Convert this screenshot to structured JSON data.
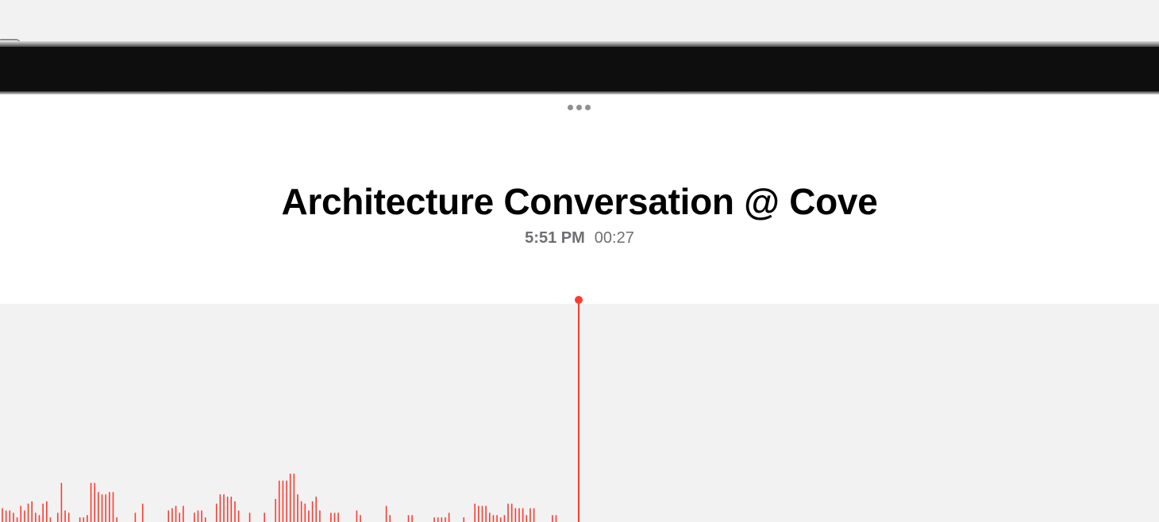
{
  "recording": {
    "title": "Architecture Conversation @ Cove",
    "time": "5:51 PM",
    "duration": "00:27"
  },
  "icons": {
    "more": "ellipsis-icon"
  },
  "colors": {
    "accent": "#ff3b30",
    "secondary_text": "#6f6f74"
  },
  "waveform": {
    "amplitudes": [
      0.06,
      0.05,
      0.05,
      0.04,
      0.02,
      0.07,
      0.05,
      0.08,
      0.09,
      0.04,
      0.03,
      0.08,
      0.09,
      0.02,
      0.0,
      0.04,
      0.17,
      0.05,
      0.04,
      0.0,
      0.0,
      0.02,
      0.02,
      0.03,
      0.17,
      0.17,
      0.13,
      0.12,
      0.12,
      0.13,
      0.13,
      0.02,
      0.0,
      0.0,
      0.0,
      0.0,
      0.04,
      0.0,
      0.08,
      0.0,
      0.0,
      0.0,
      0.0,
      0.0,
      0.0,
      0.05,
      0.06,
      0.07,
      0.04,
      0.07,
      0.0,
      0.0,
      0.04,
      0.05,
      0.05,
      0.02,
      0.0,
      0.0,
      0.08,
      0.12,
      0.12,
      0.11,
      0.11,
      0.09,
      0.05,
      0.0,
      0.0,
      0.04,
      0.0,
      0.0,
      0.0,
      0.04,
      0.0,
      0.0,
      0.1,
      0.18,
      0.18,
      0.18,
      0.21,
      0.21,
      0.12,
      0.09,
      0.08,
      0.05,
      0.09,
      0.11,
      0.05,
      0.0,
      0.0,
      0.04,
      0.04,
      0.04,
      0.0,
      0.0,
      0.0,
      0.0,
      0.05,
      0.03,
      0.0,
      0.0,
      0.0,
      0.0,
      0.0,
      0.0,
      0.07,
      0.03,
      0.0,
      0.0,
      0.0,
      0.0,
      0.03,
      0.03,
      0.0,
      0.0,
      0.0,
      0.0,
      0.0,
      0.02,
      0.02,
      0.02,
      0.02,
      0.04,
      0.0,
      0.0,
      0.0,
      0.02,
      0.0,
      0.0,
      0.08,
      0.07,
      0.07,
      0.07,
      0.04,
      0.03,
      0.03,
      0.02,
      0.03,
      0.08,
      0.08,
      0.06,
      0.06,
      0.06,
      0.03,
      0.06,
      0.06,
      0.0,
      0.0,
      0.0,
      0.0,
      0.03,
      0.03
    ]
  }
}
